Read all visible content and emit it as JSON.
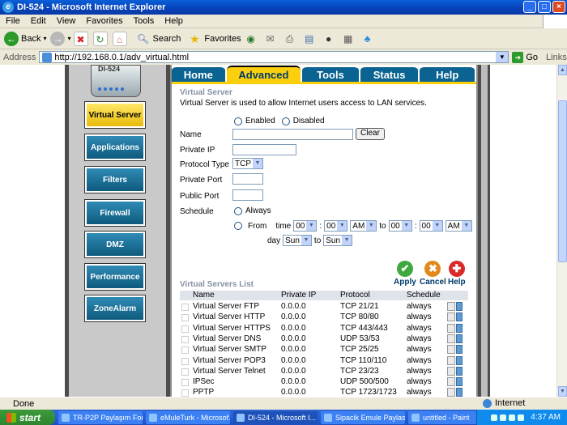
{
  "window": {
    "title": "DI-524 - Microsoft Internet Explorer"
  },
  "menu": [
    "File",
    "Edit",
    "View",
    "Favorites",
    "Tools",
    "Help"
  ],
  "toolbar": {
    "back": "Back",
    "search": "Search",
    "favorites": "Favorites"
  },
  "address": {
    "label": "Address",
    "url": "http://192.168.0.1/adv_virtual.html",
    "go": "Go",
    "links": "Links"
  },
  "router": {
    "device_label": "DI-524",
    "nav": [
      "Virtual Server",
      "Applications",
      "Filters",
      "Firewall",
      "DMZ",
      "Performance",
      "ZoneAlarm"
    ],
    "tabs": [
      "Home",
      "Advanced",
      "Tools",
      "Status",
      "Help"
    ],
    "section_title": "Virtual Server",
    "section_desc": "Virtual Server is used to allow Internet users access to LAN services.",
    "enabled": "Enabled",
    "disabled": "Disabled",
    "name_label": "Name",
    "clear": "Clear",
    "private_ip_label": "Private IP",
    "protocol_type_label": "Protocol Type",
    "protocol_value": "TCP",
    "private_port_label": "Private Port",
    "public_port_label": "Public Port",
    "schedule_label": "Schedule",
    "always": "Always",
    "from": "From",
    "time": "time",
    "hh1": "00",
    "mm1": "00",
    "ampm1": "AM",
    "to": "to",
    "hh2": "00",
    "mm2": "00",
    "ampm2": "AM",
    "day": "day",
    "day1": "Sun",
    "day2": "Sun",
    "apply": "Apply",
    "cancel": "Cancel",
    "help": "Help",
    "list_title": "Virtual Servers List",
    "list_headers": [
      "Name",
      "Private IP",
      "Protocol",
      "Schedule"
    ],
    "list_rows": [
      [
        "Virtual Server FTP",
        "0.0.0.0",
        "TCP 21/21",
        "always"
      ],
      [
        "Virtual Server HTTP",
        "0.0.0.0",
        "TCP 80/80",
        "always"
      ],
      [
        "Virtual Server HTTPS",
        "0.0.0.0",
        "TCP 443/443",
        "always"
      ],
      [
        "Virtual Server DNS",
        "0.0.0.0",
        "UDP 53/53",
        "always"
      ],
      [
        "Virtual Server SMTP",
        "0.0.0.0",
        "TCP 25/25",
        "always"
      ],
      [
        "Virtual Server POP3",
        "0.0.0.0",
        "TCP 110/110",
        "always"
      ],
      [
        "Virtual Server Telnet",
        "0.0.0.0",
        "TCP 23/23",
        "always"
      ],
      [
        "IPSec",
        "0.0.0.0",
        "UDP 500/500",
        "always"
      ],
      [
        "PPTP",
        "0.0.0.0",
        "TCP 1723/1723",
        "always"
      ]
    ]
  },
  "status": {
    "text": "Done",
    "zone": "Internet"
  },
  "taskbar": {
    "start": "start",
    "tasks": [
      "TR-P2P Paylaşım For...",
      "eMuleTurk - Microsof...",
      "DI-524 - Microsoft I...",
      "Sipacik Emule Paylasi...",
      "untitled - Paint"
    ],
    "clock": "4:37 AM"
  }
}
